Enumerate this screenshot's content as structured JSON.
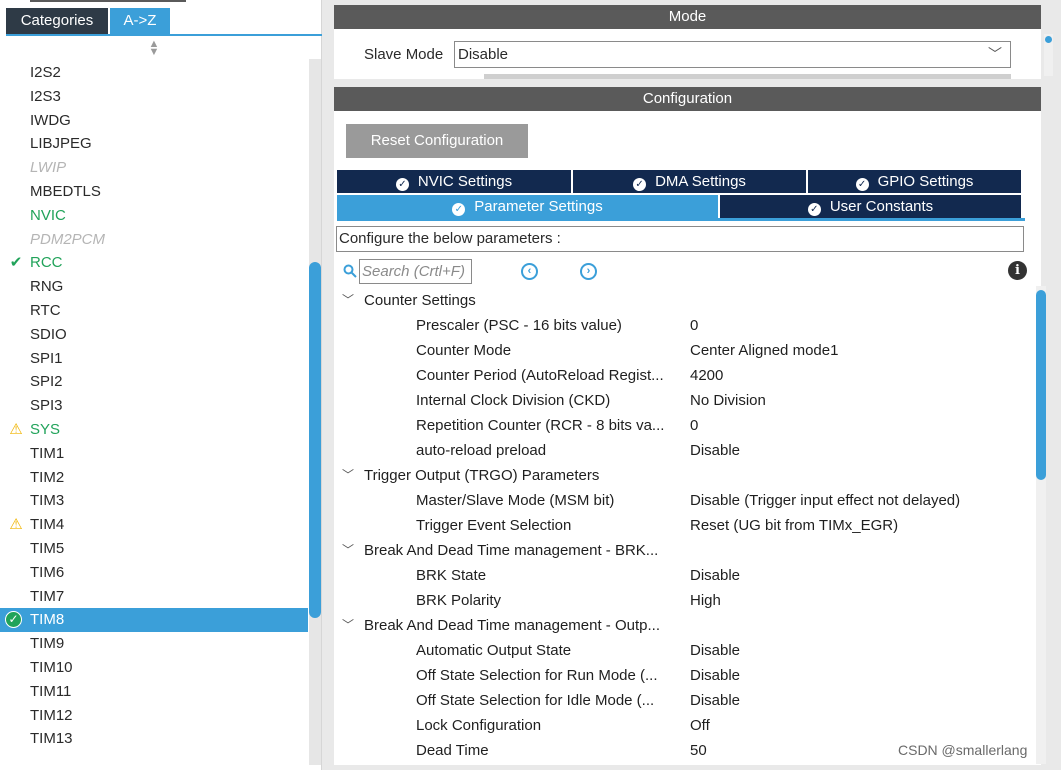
{
  "left_panel": {
    "tabs": {
      "categories": "Categories",
      "az": "A->Z"
    },
    "items": [
      {
        "label": "I2S2",
        "state": "normal",
        "mark": ""
      },
      {
        "label": "I2S3",
        "state": "normal",
        "mark": ""
      },
      {
        "label": "IWDG",
        "state": "normal",
        "mark": ""
      },
      {
        "label": "LIBJPEG",
        "state": "normal",
        "mark": ""
      },
      {
        "label": "LWIP",
        "state": "disabled",
        "mark": ""
      },
      {
        "label": "MBEDTLS",
        "state": "normal",
        "mark": ""
      },
      {
        "label": "NVIC",
        "state": "enabled",
        "mark": ""
      },
      {
        "label": "PDM2PCM",
        "state": "disabled",
        "mark": ""
      },
      {
        "label": "RCC",
        "state": "enabled",
        "mark": "check"
      },
      {
        "label": "RNG",
        "state": "normal",
        "mark": ""
      },
      {
        "label": "RTC",
        "state": "normal",
        "mark": ""
      },
      {
        "label": "SDIO",
        "state": "normal",
        "mark": ""
      },
      {
        "label": "SPI1",
        "state": "normal",
        "mark": ""
      },
      {
        "label": "SPI2",
        "state": "normal",
        "mark": ""
      },
      {
        "label": "SPI3",
        "state": "normal",
        "mark": ""
      },
      {
        "label": "SYS",
        "state": "enabled",
        "mark": "warn"
      },
      {
        "label": "TIM1",
        "state": "normal",
        "mark": ""
      },
      {
        "label": "TIM2",
        "state": "normal",
        "mark": ""
      },
      {
        "label": "TIM3",
        "state": "normal",
        "mark": ""
      },
      {
        "label": "TIM4",
        "state": "normal",
        "mark": "warn"
      },
      {
        "label": "TIM5",
        "state": "normal",
        "mark": ""
      },
      {
        "label": "TIM6",
        "state": "normal",
        "mark": ""
      },
      {
        "label": "TIM7",
        "state": "normal",
        "mark": ""
      },
      {
        "label": "TIM8",
        "state": "selected",
        "mark": "circle"
      },
      {
        "label": "TIM9",
        "state": "normal",
        "mark": ""
      },
      {
        "label": "TIM10",
        "state": "normal",
        "mark": ""
      },
      {
        "label": "TIM11",
        "state": "normal",
        "mark": ""
      },
      {
        "label": "TIM12",
        "state": "normal",
        "mark": ""
      },
      {
        "label": "TIM13",
        "state": "normal",
        "mark": ""
      }
    ]
  },
  "mode": {
    "title": "Mode",
    "slave_mode_label": "Slave Mode",
    "slave_mode_value": "Disable"
  },
  "configuration": {
    "title": "Configuration",
    "reset_label": "Reset Configuration",
    "tabs": {
      "nvic": "NVIC Settings",
      "dma": "DMA Settings",
      "gpio": "GPIO Settings",
      "parameter": "Parameter Settings",
      "user_constants": "User Constants"
    },
    "configure_text": "Configure the below parameters :",
    "search_placeholder": "Search (Crtl+F)",
    "groups": [
      {
        "title": "Counter Settings",
        "params": [
          {
            "name": "Prescaler (PSC - 16 bits value)",
            "value": "0"
          },
          {
            "name": "Counter Mode",
            "value": "Center Aligned mode1"
          },
          {
            "name": "Counter Period (AutoReload Regist...",
            "value": "4200"
          },
          {
            "name": "Internal Clock Division (CKD)",
            "value": "No Division"
          },
          {
            "name": "Repetition Counter (RCR - 8 bits va...",
            "value": "0"
          },
          {
            "name": "auto-reload preload",
            "value": "Disable"
          }
        ]
      },
      {
        "title": "Trigger Output (TRGO) Parameters",
        "params": [
          {
            "name": "Master/Slave Mode (MSM bit)",
            "value": "Disable (Trigger input effect not delayed)"
          },
          {
            "name": "Trigger Event Selection",
            "value": "Reset (UG bit from TIMx_EGR)"
          }
        ]
      },
      {
        "title": "Break And Dead Time management - BRK...",
        "params": [
          {
            "name": "BRK State",
            "value": "Disable"
          },
          {
            "name": "BRK Polarity",
            "value": "High"
          }
        ]
      },
      {
        "title": "Break And Dead Time management - Outp...",
        "params": [
          {
            "name": "Automatic Output State",
            "value": "Disable"
          },
          {
            "name": "Off State Selection for Run Mode (...",
            "value": "Disable"
          },
          {
            "name": "Off State Selection for Idle Mode (...",
            "value": "Disable"
          },
          {
            "name": "Lock Configuration",
            "value": "Off"
          },
          {
            "name": "Dead Time",
            "value": "50"
          }
        ]
      }
    ]
  },
  "watermark": "CSDN @smallerlang",
  "colors": {
    "accent": "#3b9fd9",
    "dark_tab": "#12294f",
    "header_bar": "#5a5a5a",
    "enabled_green": "#21a35a",
    "warning_yellow": "#f0b400"
  }
}
